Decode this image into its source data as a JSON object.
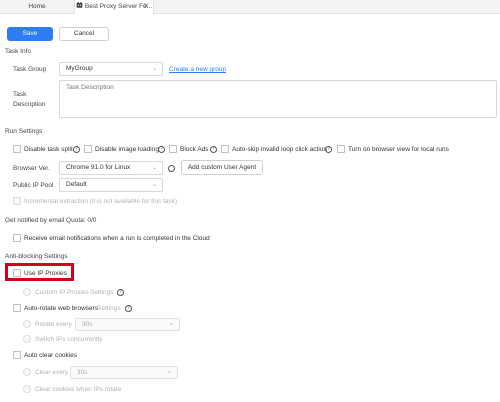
{
  "tabs": [
    {
      "label": "Home",
      "icon": "home-tab",
      "active": false
    },
    {
      "label": "Best Proxy Server Fo...",
      "icon": "octoparse-logo-icon",
      "active": true
    }
  ],
  "toolbar": {
    "save_label": "Save",
    "cancel_label": "Cancel"
  },
  "task_info": {
    "title": "Task Info",
    "group_label": "Task Group",
    "group_value": "MyGroup",
    "create_group_link": "Create a new group",
    "description_label_1": "Task",
    "description_label_2": "Description",
    "description_placeholder": "Task Description"
  },
  "run_settings": {
    "title": "Run Settings",
    "options": [
      {
        "label": "Disable task split",
        "help": true
      },
      {
        "label": "Disable image loading",
        "help": true
      },
      {
        "label": "Block Ads",
        "help": true
      },
      {
        "label": "Auto-skip invalid loop click action",
        "help": true
      },
      {
        "label": "Turn on browser view for local runs",
        "help": false
      }
    ],
    "browser_ver_label": "Browser Ver.",
    "browser_ver_value": "Chrome 91.0 for Linux",
    "add_user_agent_label": "Add custom User Agent",
    "public_ip_pool_label": "Public IP Pool",
    "public_ip_pool_value": "Default",
    "incremental_label": "Incremental extraction (it is not available for this task)"
  },
  "notify": {
    "title": "Get notified by email Quota: 0/0",
    "option_label": "Receive email notifications when a run is completed in the Cloud"
  },
  "anti_blocking": {
    "title": "Anti-blocking Settings",
    "use_ip_proxies": "Use IP Proxies",
    "custom_ip_proxies": "Custom IP Proxies",
    "settings_label": "Settings",
    "auto_rotate_label": "Auto-rotate web browsers",
    "auto_rotate_settings": "Settings",
    "rotate_every_label": "Rotate every",
    "rotate_every_value": "30s",
    "switch_ips_label": "Switch IPs concurrently",
    "auto_clear_label": "Auto clear cookies",
    "clear_every_label": "Clear every",
    "clear_every_value": "30s",
    "clear_when_ips_label": "Clear cookies when IPs rotate"
  },
  "colors": {
    "accent": "#2f7df6",
    "highlight": "#d0021b"
  }
}
